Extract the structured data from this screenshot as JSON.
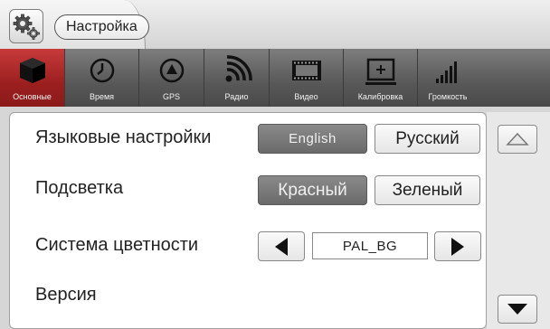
{
  "header": {
    "title": "Настройка",
    "icon": "gears-icon"
  },
  "tabs": [
    {
      "label": "Основные",
      "icon": "cube-icon",
      "active": true
    },
    {
      "label": "Время",
      "icon": "clock-icon",
      "active": false
    },
    {
      "label": "GPS",
      "icon": "gps-icon",
      "active": false
    },
    {
      "label": "Радио",
      "icon": "radio-signal-icon",
      "active": false
    },
    {
      "label": "Видео",
      "icon": "film-icon",
      "active": false
    },
    {
      "label": "Калибровка",
      "icon": "calibration-icon",
      "active": false
    },
    {
      "label": "Громкость",
      "icon": "volume-bars-icon",
      "active": false
    }
  ],
  "settings": {
    "language": {
      "label": "Языковые настройки",
      "options": [
        "English",
        "Русский"
      ],
      "selected": "English"
    },
    "backlight": {
      "label": "Подсветка",
      "options": [
        "Красный",
        "Зеленый"
      ],
      "selected": "Красный"
    },
    "color_system": {
      "label": "Система цветности",
      "value": "PAL_BG"
    },
    "version": {
      "label": "Версия"
    }
  },
  "colors": {
    "accent_active_tab": "#9c1f1f",
    "tabbar_bg": "#585858",
    "selected_button": "#777777"
  }
}
